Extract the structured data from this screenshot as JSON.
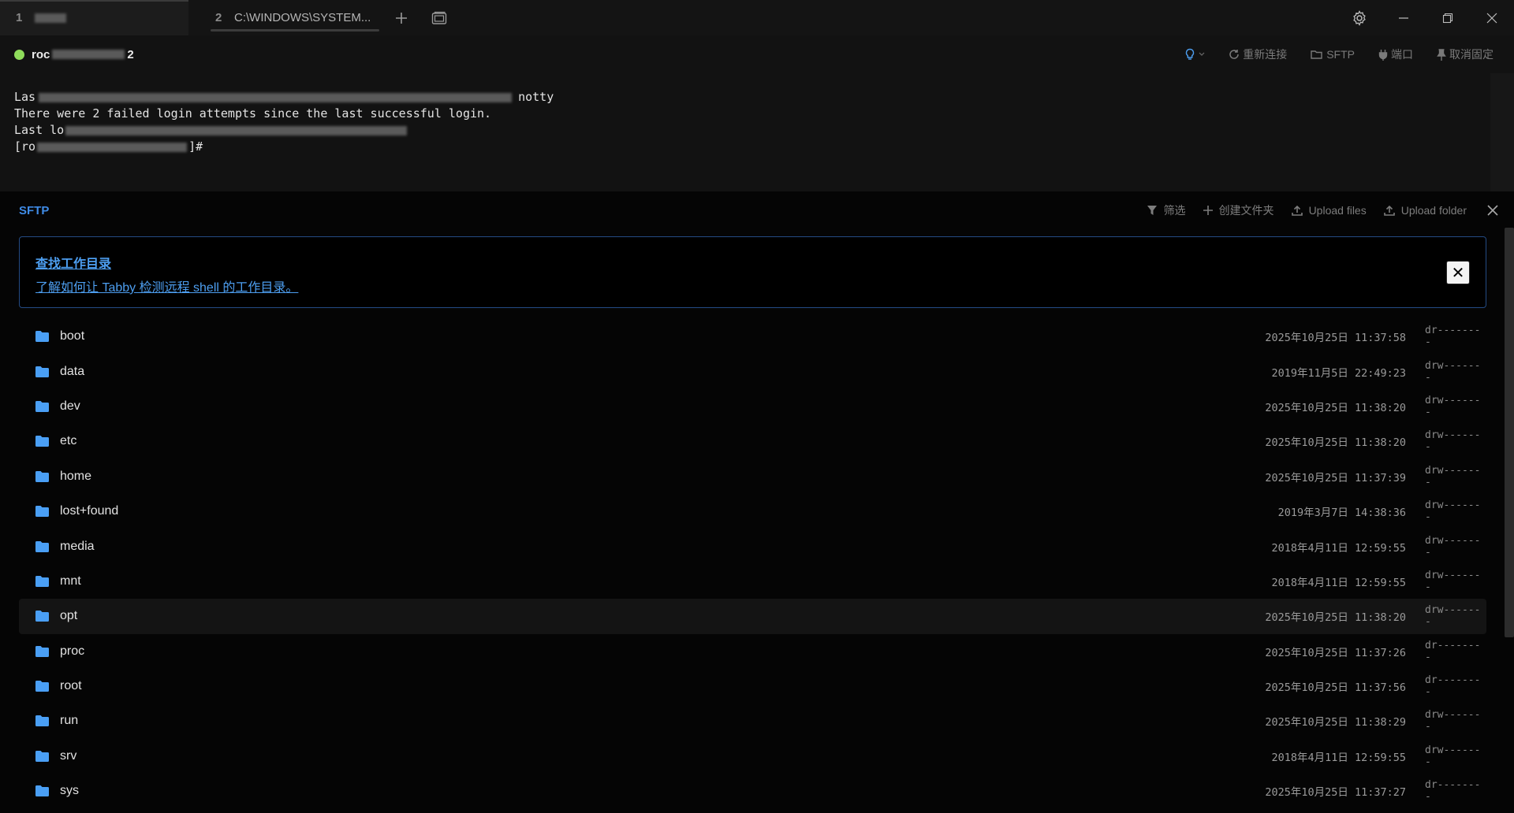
{
  "tabs": [
    {
      "num": "1",
      "title": ""
    },
    {
      "num": "2",
      "title": "C:\\WINDOWS\\SYSTEM..."
    }
  ],
  "session": {
    "host_prefix": "roc",
    "host_suffix": "2",
    "status_color": "#8fdc5b",
    "actions": {
      "reconnect": "重新连接",
      "sftp": "SFTP",
      "ports": "端口",
      "unpin": "取消固定"
    }
  },
  "terminal": {
    "line1_start": "Las",
    "line1_end": "notty",
    "line2": "There were 2 failed login attempts since the last successful login.",
    "line3_start": "Last lo",
    "line4_start": "[ro",
    "line4_end": "]#"
  },
  "sftp": {
    "title": "SFTP",
    "accent": "#3f8be6",
    "actions": {
      "filter": "筛选",
      "create_folder": "创建文件夹",
      "upload_files": "Upload files",
      "upload_folder": "Upload folder"
    },
    "alert": {
      "title": "查找工作目录",
      "link": "了解如何让 Tabby 检测远程 shell 的工作目录。"
    },
    "files": [
      {
        "name": "boot",
        "date": "2025年10月25日 11:37:58",
        "perm": "dr--------"
      },
      {
        "name": "data",
        "date": "2019年11月5日 22:49:23",
        "perm": "drw-------"
      },
      {
        "name": "dev",
        "date": "2025年10月25日 11:38:20",
        "perm": "drw-------"
      },
      {
        "name": "etc",
        "date": "2025年10月25日 11:38:20",
        "perm": "drw-------"
      },
      {
        "name": "home",
        "date": "2025年10月25日 11:37:39",
        "perm": "drw-------"
      },
      {
        "name": "lost+found",
        "date": "2019年3月7日 14:38:36",
        "perm": "drw-------"
      },
      {
        "name": "media",
        "date": "2018年4月11日 12:59:55",
        "perm": "drw-------"
      },
      {
        "name": "mnt",
        "date": "2018年4月11日 12:59:55",
        "perm": "drw-------"
      },
      {
        "name": "opt",
        "date": "2025年10月25日 11:38:20",
        "perm": "drw-------"
      },
      {
        "name": "proc",
        "date": "2025年10月25日 11:37:26",
        "perm": "dr--------"
      },
      {
        "name": "root",
        "date": "2025年10月25日 11:37:56",
        "perm": "dr--------"
      },
      {
        "name": "run",
        "date": "2025年10月25日 11:38:29",
        "perm": "drw-------"
      },
      {
        "name": "srv",
        "date": "2018年4月11日 12:59:55",
        "perm": "drw-------"
      },
      {
        "name": "sys",
        "date": "2025年10月25日 11:37:27",
        "perm": "dr--------"
      }
    ]
  }
}
